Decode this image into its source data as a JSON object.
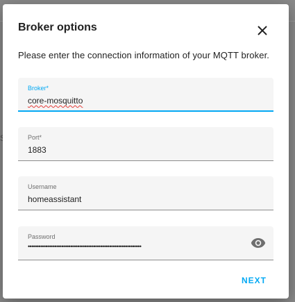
{
  "dialog": {
    "title": "Broker options",
    "description": "Please enter the connection information of your MQTT broker.",
    "next_label": "NEXT"
  },
  "fields": {
    "broker": {
      "label": "Broker*",
      "value": "core-mosquitto"
    },
    "port": {
      "label": "Port*",
      "value": "1883"
    },
    "username": {
      "label": "Username",
      "value": "homeassistant"
    },
    "password": {
      "label": "Password",
      "value": "••••••••••••••••••••••••••••••••••••••••••••••••••••••••••••••••"
    }
  },
  "icons": {
    "close": "close-icon",
    "visibility": "eye-icon"
  },
  "colors": {
    "accent": "#03a9f4",
    "spellcheck": "#e53935"
  }
}
